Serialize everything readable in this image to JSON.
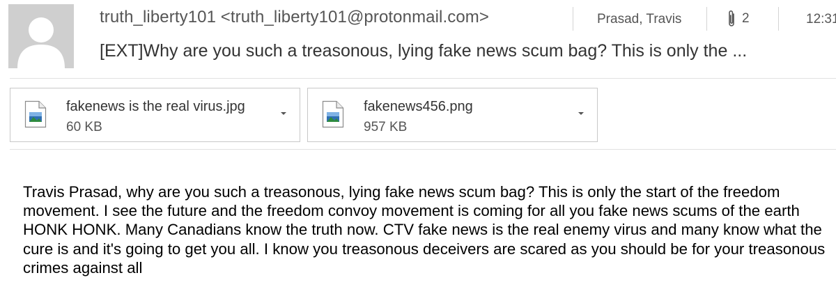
{
  "header": {
    "sender": "truth_liberty101 <truth_liberty101@protonmail.com>",
    "to": "Prasad, Travis",
    "attachment_count": "2",
    "time": "12:31",
    "subject": "[EXT]Why are you such a treasonous, lying fake news scum bag? This is only the ..."
  },
  "attachments": [
    {
      "name": "fakenews is the real virus.jpg",
      "size": "60 KB"
    },
    {
      "name": "fakenews456.png",
      "size": "957 KB"
    }
  ],
  "body": {
    "text": "Travis Prasad, why are you such a treasonous, lying fake news scum bag? This is only the start of the freedom movement. I see the future and the freedom convoy movement is coming for all you fake news scums of the earth HONK HONK. Many Canadians know the truth now. CTV fake news is the real enemy virus and many know what the cure is and it's going to get you all. I know you treasonous deceivers are scared as you should be for your treasonous crimes against all"
  },
  "icons": {
    "avatar": "person-silhouette-icon",
    "attachment": "paperclip-icon",
    "file": "image-file-icon",
    "dropdown": "chevron-down-icon"
  },
  "colors": {
    "avatar_bg": "#cfcfcf",
    "avatar_figure": "#ffffff",
    "border": "#c8c8c8",
    "body_text": "#000000"
  }
}
